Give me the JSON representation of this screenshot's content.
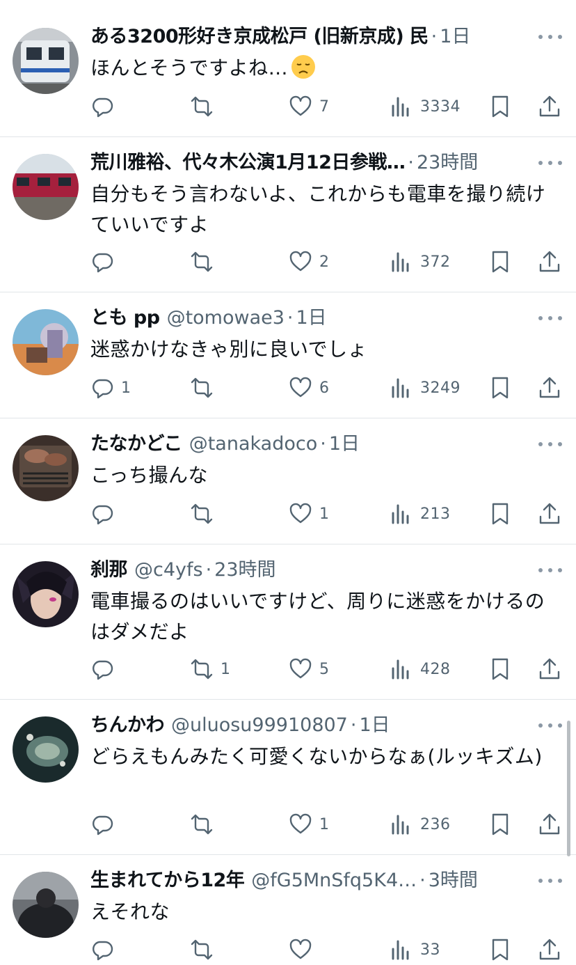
{
  "tweets": [
    {
      "name": "ある3200形好き京成松戸 (旧新京成) 民",
      "handle": "",
      "time": "1日",
      "text": "ほんとそうですよね…",
      "emoji": "disappointed-face-emoji",
      "avatar": "train-photo-avatar",
      "replies": "",
      "retweets": "",
      "likes": "7",
      "views": "3334"
    },
    {
      "name": "荒川雅裕、代々木公演1月12日参戦…",
      "handle": "",
      "time": "23時間",
      "text": "自分もそう言わないよ、これからも電車を撮り続けていいですよ",
      "avatar": "red-trains-photo-avatar",
      "replies": "",
      "retweets": "",
      "likes": "2",
      "views": "372"
    },
    {
      "name": "とも pp",
      "handle": "@tomowae3",
      "time": "1日",
      "text": "迷惑かけなきゃ別に良いでしょ",
      "avatar": "anime-robot-avatar",
      "replies": "1",
      "retweets": "",
      "likes": "6",
      "views": "3249"
    },
    {
      "name": "たなかどこ",
      "handle": "@tanakadoco",
      "time": "1日",
      "text": "こっち撮んな",
      "avatar": "grilled-meat-avatar",
      "replies": "",
      "retweets": "",
      "likes": "1",
      "views": "213"
    },
    {
      "name": "刹那",
      "handle": "@c4yfs",
      "time": "23時間",
      "text": "電車撮るのはいいですけど、周りに迷惑をかけるのはダメだよ",
      "avatar": "anime-character-avatar",
      "replies": "",
      "retweets": "1",
      "likes": "5",
      "views": "428"
    },
    {
      "name": "ちんかわ",
      "handle": "@uluosu99910807",
      "time": "1日",
      "text": "どらえもんみたく可愛くないからなぁ(ルッキズム)",
      "avatar": "dark-illustration-avatar",
      "replies": "",
      "retweets": "",
      "likes": "1",
      "views": "236"
    },
    {
      "name": "生まれてから12年",
      "handle": "@fG5MnSfq5K4…",
      "time": "3時間",
      "text": "えそれな",
      "avatar": "person-bowing-avatar",
      "replies": "",
      "retweets": "",
      "likes": "",
      "views": "33"
    }
  ],
  "icons": {
    "reply": "reply-icon",
    "retweet": "retweet-icon",
    "like": "like-icon",
    "views": "views-icon",
    "bookmark": "bookmark-icon",
    "share": "share-icon",
    "more": "more-icon"
  },
  "colors": {
    "text": "#0f1419",
    "secondary": "#536471",
    "divider": "#e1e5e8"
  }
}
